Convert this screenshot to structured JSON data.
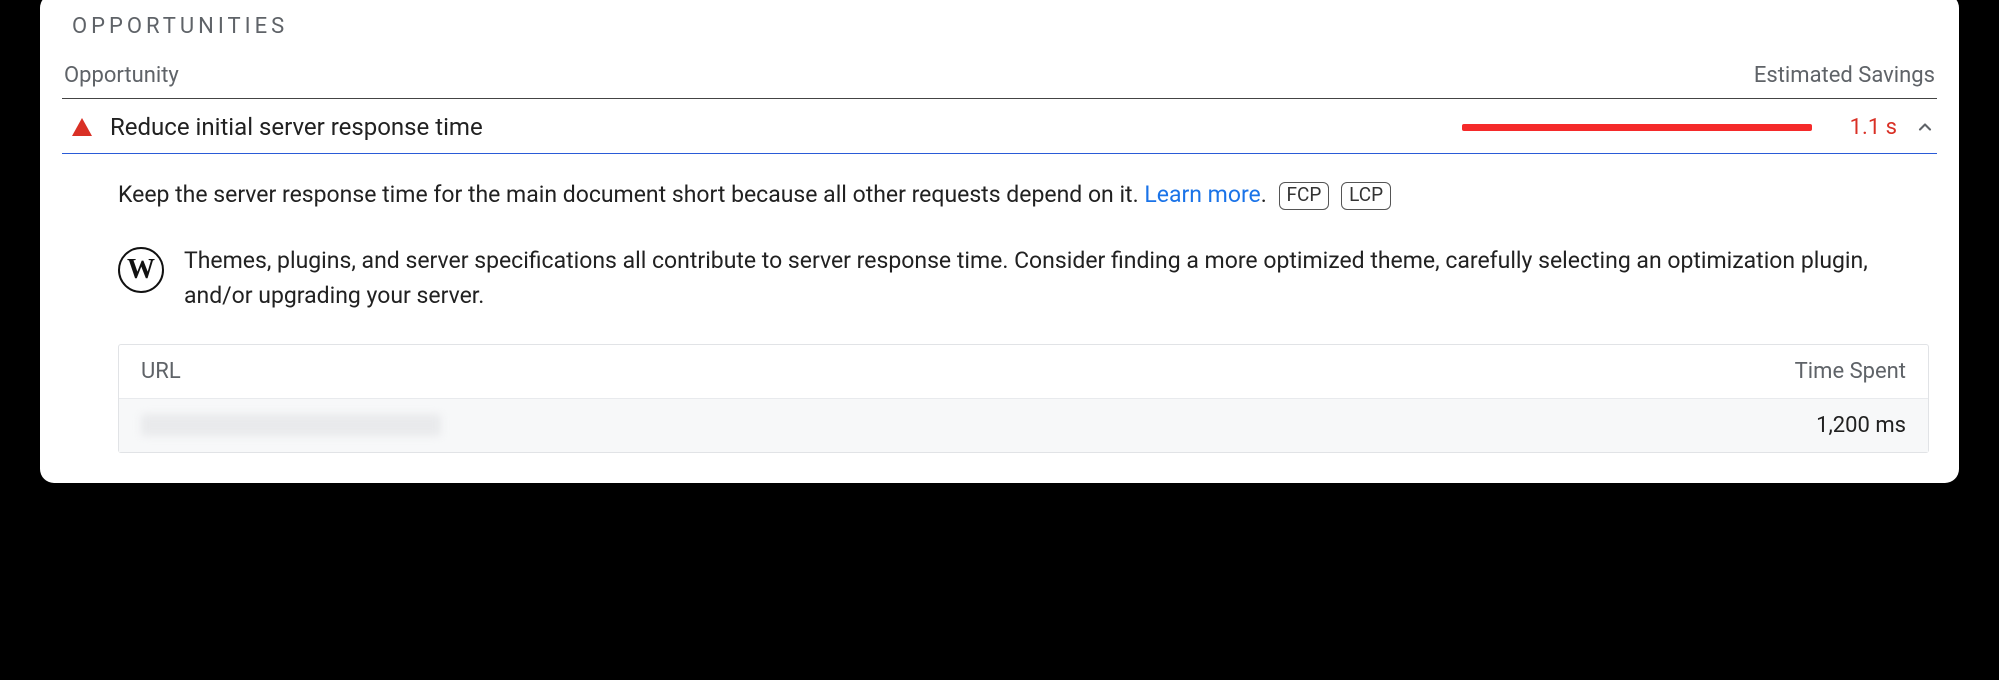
{
  "section_title": "OPPORTUNITIES",
  "columns": {
    "left": "Opportunity",
    "right": "Estimated Savings"
  },
  "opportunity": {
    "title": "Reduce initial server response time",
    "savings": "1.1 s",
    "description": "Keep the server response time for the main document short because all other requests depend on it. ",
    "learn_more": "Learn more",
    "badges": [
      "FCP",
      "LCP"
    ],
    "stack_advice": "Themes, plugins, and server specifications all contribute to server response time. Consider finding a more optimized theme, carefully selecting an optimization plugin, and/or upgrading your server.",
    "stack_icon": "wordpress-icon"
  },
  "url_table": {
    "head_left": "URL",
    "head_right": "Time Spent",
    "row_time": "1,200 ms"
  }
}
